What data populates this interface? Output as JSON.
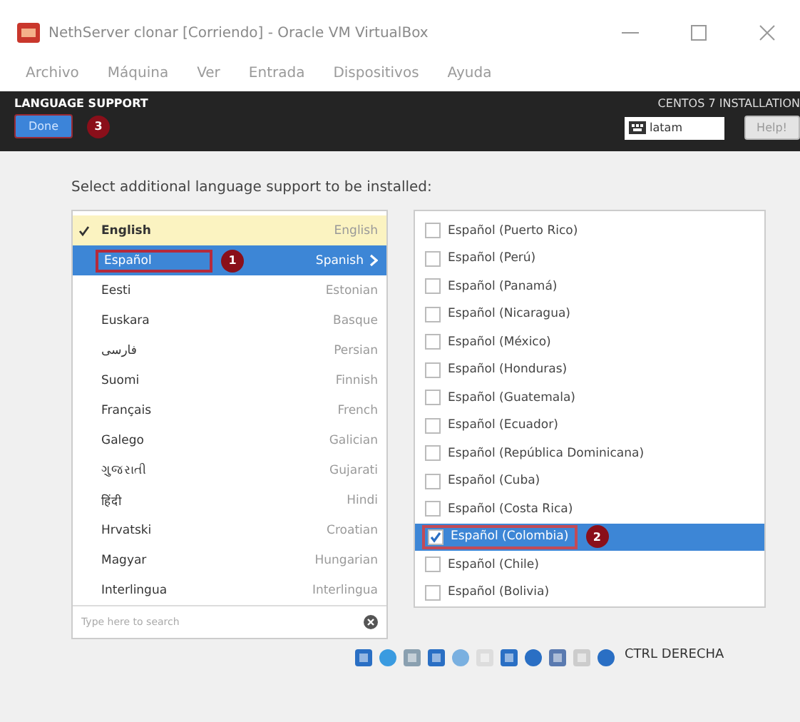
{
  "window": {
    "title": "NethServer clonar [Corriendo] - Oracle VM VirtualBox"
  },
  "menu": [
    "Archivo",
    "Máquina",
    "Ver",
    "Entrada",
    "Dispositivos",
    "Ayuda"
  ],
  "header": {
    "title": "LANGUAGE SUPPORT",
    "done_button": "Done",
    "done_callout": "3",
    "product": "CENTOS 7 INSTALLATION",
    "keyboard": "latam",
    "help_button": "Help!"
  },
  "prompt": "Select additional language support to be installed:",
  "languages": [
    {
      "native": "English",
      "english": "English",
      "checked": true,
      "selected": false
    },
    {
      "native": "Español",
      "english": "Spanish",
      "checked": false,
      "selected": true,
      "callout": "1"
    },
    {
      "native": "Eesti",
      "english": "Estonian",
      "checked": false,
      "selected": false
    },
    {
      "native": "Euskara",
      "english": "Basque",
      "checked": false,
      "selected": false
    },
    {
      "native": "فارسی",
      "english": "Persian",
      "checked": false,
      "selected": false
    },
    {
      "native": "Suomi",
      "english": "Finnish",
      "checked": false,
      "selected": false
    },
    {
      "native": "Français",
      "english": "French",
      "checked": false,
      "selected": false
    },
    {
      "native": "Galego",
      "english": "Galician",
      "checked": false,
      "selected": false
    },
    {
      "native": "ગુજરાતી",
      "english": "Gujarati",
      "checked": false,
      "selected": false
    },
    {
      "native": "हिंदी",
      "english": "Hindi",
      "checked": false,
      "selected": false
    },
    {
      "native": "Hrvatski",
      "english": "Croatian",
      "checked": false,
      "selected": false
    },
    {
      "native": "Magyar",
      "english": "Hungarian",
      "checked": false,
      "selected": false
    },
    {
      "native": "Interlingua",
      "english": "Interlingua",
      "checked": false,
      "selected": false
    }
  ],
  "search": {
    "placeholder": "Type here to search"
  },
  "locales": [
    {
      "label": "Español (Puerto Rico)",
      "checked": false,
      "selected": false
    },
    {
      "label": "Español (Perú)",
      "checked": false,
      "selected": false
    },
    {
      "label": "Español (Panamá)",
      "checked": false,
      "selected": false
    },
    {
      "label": "Español (Nicaragua)",
      "checked": false,
      "selected": false
    },
    {
      "label": "Español (México)",
      "checked": false,
      "selected": false
    },
    {
      "label": "Español (Honduras)",
      "checked": false,
      "selected": false
    },
    {
      "label": "Español (Guatemala)",
      "checked": false,
      "selected": false
    },
    {
      "label": "Español (Ecuador)",
      "checked": false,
      "selected": false
    },
    {
      "label": "Español (República Dominicana)",
      "checked": false,
      "selected": false
    },
    {
      "label": "Español (Cuba)",
      "checked": false,
      "selected": false
    },
    {
      "label": "Español (Costa Rica)",
      "checked": false,
      "selected": false
    },
    {
      "label": "Español (Colombia)",
      "checked": true,
      "selected": true,
      "callout": "2"
    },
    {
      "label": "Español (Chile)",
      "checked": false,
      "selected": false
    },
    {
      "label": "Español (Bolivia)",
      "checked": false,
      "selected": false
    }
  ],
  "status_bar": {
    "host_key": "CTRL DERECHA"
  }
}
